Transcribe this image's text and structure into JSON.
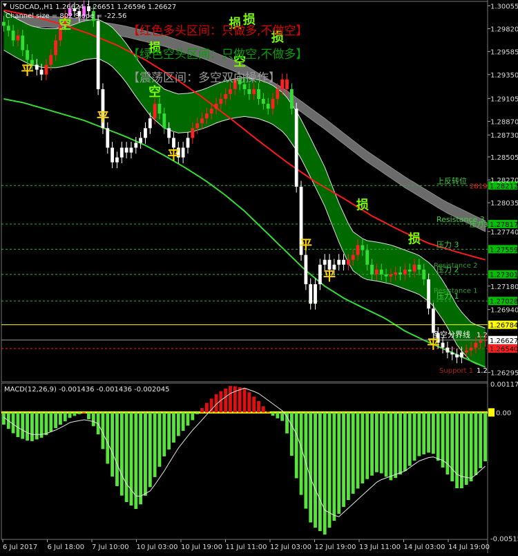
{
  "header": {
    "symbol": "USDCAD,,H1",
    "ohlc": "1.26624 1.26651 1.26596 1.26627",
    "channel_info": "Channel size = 802 Slope = -22.56"
  },
  "banners": [
    {
      "text": "【红色多头区间：只做多,不做空】",
      "color": "#d80000"
    },
    {
      "text": "【绿色空头区间：只做空,不做多】",
      "color": "#00a000"
    },
    {
      "text": "【震荡区间：多空双向操作】",
      "color": "#9a9a9a"
    }
  ],
  "markers": [
    {
      "text": "空",
      "color": "#7cfc00",
      "t": 13,
      "p": 1.2982
    },
    {
      "text": "平",
      "color": "#ffd400",
      "t": 5,
      "p": 1.2935
    },
    {
      "text": "损",
      "color": "#7cfc00",
      "t": 32,
      "p": 1.2958
    },
    {
      "text": "平",
      "color": "#ffd400",
      "t": 21,
      "p": 1.2887
    },
    {
      "text": "空",
      "color": "#7cfc00",
      "t": 32,
      "p": 1.2913
    },
    {
      "text": "平",
      "color": "#ffd400",
      "t": 36,
      "p": 1.2848
    },
    {
      "text": "损",
      "color": "#7cfc00",
      "t": 49,
      "p": 1.2983
    },
    {
      "text": "损",
      "color": "#7cfc00",
      "t": 52,
      "p": 1.2987
    },
    {
      "text": "空",
      "color": "#7cfc00",
      "t": 50,
      "p": 1.2944
    },
    {
      "text": "损",
      "color": "#7cfc00",
      "t": 58,
      "p": 1.2969
    },
    {
      "text": "平",
      "color": "#ffd400",
      "t": 64,
      "p": 1.2756
    },
    {
      "text": "平",
      "color": "#ffd400",
      "t": 69,
      "p": 1.2724
    },
    {
      "text": "损",
      "color": "#7cfc00",
      "t": 76,
      "p": 1.2797
    },
    {
      "text": "损",
      "color": "#7cfc00",
      "t": 87,
      "p": 1.2762
    },
    {
      "text": "平",
      "color": "#ffd400",
      "t": 91,
      "p": 1.2654
    }
  ],
  "price_levels": [
    {
      "price": 1.28212,
      "label": "上反转位",
      "label_color": "#3cd23c",
      "extra": "2819",
      "extra_color": "#ff2020",
      "box_color": "#00c000"
    },
    {
      "price": 1.27817,
      "label": "Resistance 3",
      "label_color": "#3cd23c",
      "extra": "压力3",
      "extra_color": "#3cd23c",
      "box_color": "#00c000"
    },
    {
      "price": 1.27559,
      "label": "压力 3",
      "label_color": "#3cd23c",
      "extra": "",
      "extra_color": "#3cd23c",
      "box_color": "#00c000"
    },
    {
      "price": 1.27301,
      "label": "压力 2",
      "label_color": "#3cd23c",
      "extra": "",
      "extra_color": "#3cd23c",
      "box_color": "#00c000"
    },
    {
      "price": 1.27028,
      "label": "压力 1",
      "label_color": "#3cd23c",
      "extra": "",
      "extra_color": "#3cd23c",
      "box_color": "#00c000"
    }
  ],
  "level_texts": [
    {
      "text": "Resistance 2",
      "price": 1.274,
      "color": "#2e9e2e"
    },
    {
      "text": "Resistance 1",
      "price": 1.2714,
      "color": "#2e9e2e"
    }
  ],
  "boundary": {
    "price": 1.26784,
    "label": "多空分界线",
    "label_price": 1.26685,
    "value_text": "1.2",
    "box_color": "#ffff00"
  },
  "current_price": {
    "price": 1.26627,
    "label": "1.26627"
  },
  "red_level": {
    "price": 1.2654,
    "label": "1.26540"
  },
  "support": {
    "text": "Support 1",
    "price": 1.2632,
    "color": "#b02020",
    "side_text": "1.2"
  },
  "y_axis_ticks": [
    "1.30055",
    "1.29820",
    "1.29585",
    "1.29350",
    "1.29105",
    "1.28870",
    "1.28730",
    "1.28505",
    "1.28270",
    "1.28035",
    "1.27740",
    "1.27180",
    "1.26940",
    "1.26295"
  ],
  "macd": {
    "label": "MACD(12,26,9) -0.001436 -0.001436 -0.002045",
    "axis_ticks": [
      "0.00117",
      "0.00",
      "-0.005155"
    ],
    "zero_label": "0.00"
  },
  "x_axis_labels": [
    "6 Jul 2017",
    "6 Jul 18:00",
    "7 Jul 10:00",
    "10 Jul 03:00",
    "10 Jul 19:00",
    "11 Jul 11:00",
    "12 Jul 03:00",
    "12 Jul 19:00",
    "13 Jul 11:00",
    "14 Jul 03:00",
    "14 Jul 19:00"
  ],
  "chart_data": {
    "type": "candlestick",
    "instrument": "USDCAD",
    "timeframe": "H1",
    "ylim": [
      1.262,
      1.301
    ],
    "bars": 103,
    "close_series": [
      1.2985,
      1.298,
      1.297,
      1.2975,
      1.296,
      1.295,
      1.2945,
      1.294,
      1.2935,
      1.2945,
      1.2955,
      1.297,
      1.2985,
      1.2995,
      1.3003,
      1.3,
      1.2995,
      1.3005,
      1.3,
      1.299,
      1.292,
      1.288,
      1.286,
      1.2845,
      1.285,
      1.286,
      1.2855,
      1.286,
      1.2865,
      1.287,
      1.288,
      1.289,
      1.2905,
      1.2895,
      1.288,
      1.287,
      1.286,
      1.285,
      1.286,
      1.287,
      1.288,
      1.2885,
      1.289,
      1.2895,
      1.29,
      1.2905,
      1.291,
      1.2915,
      1.292,
      1.293,
      1.2925,
      1.292,
      1.2915,
      1.292,
      1.291,
      1.2905,
      1.29,
      1.291,
      1.292,
      1.293,
      1.292,
      1.29,
      1.282,
      1.275,
      1.272,
      1.27,
      1.272,
      1.274,
      1.2745,
      1.2735,
      1.274,
      1.2745,
      1.274,
      1.2745,
      1.275,
      1.276,
      1.2755,
      1.274,
      1.273,
      1.2735,
      1.273,
      1.2728,
      1.273,
      1.2732,
      1.273,
      1.2735,
      1.2733,
      1.274,
      1.2735,
      1.2725,
      1.2695,
      1.267,
      1.266,
      1.2655,
      1.265,
      1.2648,
      1.2645,
      1.265,
      1.2652,
      1.2655,
      1.266,
      1.2662,
      1.2663
    ],
    "channel_mid": [
      1.298,
      1.2972,
      1.2965,
      1.2962,
      1.2962,
      1.2965,
      1.297,
      1.2972,
      1.2965,
      1.295,
      1.293,
      1.2912,
      1.29,
      1.2895,
      1.2896,
      1.29,
      1.2906,
      1.291,
      1.2912,
      1.291,
      1.2905,
      1.2895,
      1.2875,
      1.2848,
      1.282,
      1.2785,
      1.2755,
      1.2745,
      1.2743,
      1.274,
      1.2735,
      1.273,
      1.272,
      1.27,
      1.2675,
      1.266,
      1.2655
    ],
    "channel_width": 0.004,
    "ma_red": [
      1.3001,
      1.2995,
      1.2987,
      1.2977,
      1.2965,
      1.295,
      1.2932,
      1.2912,
      1.289,
      1.2867,
      1.2845,
      1.2825,
      1.2808,
      1.279,
      1.2775,
      1.2762,
      1.2753,
      1.2745
    ],
    "ma_green": [
      1.291,
      1.2906,
      1.29,
      1.2894,
      1.2888,
      1.288,
      1.2872,
      1.2863,
      1.2852,
      1.284,
      1.2827,
      1.2812,
      1.2795,
      1.2775,
      1.2755,
      1.2735,
      1.2718,
      1.2705,
      1.2695,
      1.2685,
      1.2672,
      1.2662,
      1.2653,
      1.2644,
      1.2635
    ],
    "gray_band_top": [
      1.2994,
      1.2995,
      1.2992,
      1.2985,
      1.2975,
      1.2962,
      1.2945,
      1.292,
      1.289,
      1.2858,
      1.283,
      1.2805,
      1.2785
    ],
    "gray_band_width": 0.0011,
    "macd_hist": [
      -0.0005,
      -0.001,
      -0.0012,
      -0.001,
      -0.0006,
      -0.0002,
      0.0,
      -0.0008,
      -0.0025,
      -0.0036,
      -0.004,
      -0.003,
      -0.0018,
      -0.001,
      -0.0004,
      0.0003,
      0.0008,
      0.0011,
      0.001,
      0.0005,
      -0.0001,
      -0.0004,
      -0.003,
      -0.0046,
      -0.005,
      -0.0042,
      -0.0034,
      -0.0028,
      -0.0024,
      -0.0028,
      -0.0024,
      -0.0018,
      -0.0016,
      -0.0024,
      -0.0032,
      -0.0028,
      -0.002
    ],
    "macd_signal": [
      -0.0002,
      -0.0006,
      -0.0009,
      -0.0009,
      -0.0007,
      -0.0004,
      -0.0003,
      -0.0004,
      -0.0015,
      -0.0028,
      -0.0035,
      -0.0032,
      -0.0024,
      -0.0015,
      -0.0008,
      -0.0002,
      0.0004,
      0.0008,
      0.001,
      0.0008,
      0.0004,
      0.0,
      -0.001,
      -0.0028,
      -0.004,
      -0.0043,
      -0.0038,
      -0.0033,
      -0.0028,
      -0.0026,
      -0.0024,
      -0.002,
      -0.0018,
      -0.002,
      -0.0026,
      -0.0027,
      -0.0022
    ],
    "macd_ylim": [
      -0.0052,
      0.0012
    ]
  }
}
